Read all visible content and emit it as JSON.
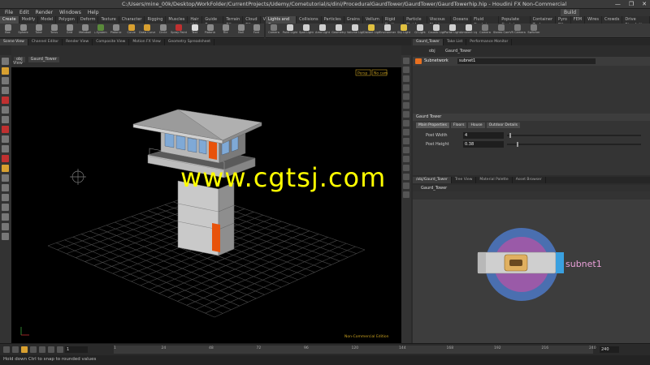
{
  "window": {
    "title": "C:/Users/mine_00k/Desktop/WorkFolder/CurrentProjects/Udemy/Cometutorial/s/dini/ProceduralGaurdTower/GaurdTower/GaurdTowerhip.hip - Houdini FX Non-Commercial",
    "controls": [
      "—",
      "❐",
      "✕"
    ]
  },
  "menu": {
    "items": [
      "File",
      "Edit",
      "Render",
      "Windows",
      "Help"
    ],
    "desktop": "Build"
  },
  "shelf_left": {
    "tabs": [
      "Create",
      "Modify",
      "Model",
      "Polygon",
      "Deform",
      "Texture",
      "Character",
      "Rigging",
      "Muscles",
      "Hair Utils",
      "Guide Process",
      "Terrain FX",
      "Cloud FX",
      "Volume"
    ],
    "active_tab": 0,
    "tools": [
      {
        "label": "Box",
        "color": "#8a8a8a"
      },
      {
        "label": "Sphere",
        "color": "#8a8a8a"
      },
      {
        "label": "Tube",
        "color": "#8a8a8a"
      },
      {
        "label": "Torus",
        "color": "#8a8a8a"
      },
      {
        "label": "Grid",
        "color": "#8a8a8a"
      },
      {
        "label": "Metaball",
        "color": "#8a8a8a"
      },
      {
        "label": "L-System",
        "color": "#5a8a3a"
      },
      {
        "label": "Platonic",
        "color": "#8a8a8a"
      },
      {
        "label": "Curve",
        "color": "#d8a030"
      },
      {
        "label": "Draw Curve",
        "color": "#d8a030"
      },
      {
        "label": "Circle",
        "color": "#8a8a8a"
      },
      {
        "label": "Spray Paint",
        "color": "#c03030"
      },
      {
        "label": "Text",
        "color": "#dddddd"
      },
      {
        "label": "Platonic",
        "color": "#8a8a8a"
      },
      {
        "label": "File",
        "color": "#8a8a8a"
      },
      {
        "label": "Null",
        "color": "#8a8a8a"
      },
      {
        "label": "Font",
        "color": "#8a8a8a"
      }
    ]
  },
  "shelf_right": {
    "tabs": [
      "Lights and Cameras",
      "Collisions",
      "Particles",
      "Grains",
      "Vellum",
      "Rigid Bodies",
      "Particle Fluids",
      "Viscous Fluids",
      "Oceans",
      "Fluid Containers",
      "Populate Containers",
      "Container Tools",
      "Pyro FX",
      "FEM",
      "Wires",
      "Crowds",
      "Drive Simulation"
    ],
    "active_tab": 0,
    "tools": [
      {
        "label": "Camera",
        "color": "#7a7a7a"
      },
      {
        "label": "Point Light",
        "color": "#d0d0d0"
      },
      {
        "label": "Spot Light",
        "color": "#d0d0d0"
      },
      {
        "label": "Area Light",
        "color": "#d0d0d0"
      },
      {
        "label": "Geometry",
        "color": "#d0d0d0"
      },
      {
        "label": "Volume Light",
        "color": "#d0d0d0"
      },
      {
        "label": "Distant Light",
        "color": "#e0c040"
      },
      {
        "label": "Environment",
        "color": "#d0d0d0"
      },
      {
        "label": "Sky Light",
        "color": "#e0c040"
      },
      {
        "label": "GI Light",
        "color": "#d0d0d0"
      },
      {
        "label": "Caustic Light",
        "color": "#d0d0d0"
      },
      {
        "label": "Portal Light",
        "color": "#d0d0d0"
      },
      {
        "label": "Ambient Light",
        "color": "#d0d0d0"
      },
      {
        "label": "Camera",
        "color": "#7a7a7a"
      },
      {
        "label": "Stereo Cam",
        "color": "#7a7a7a"
      },
      {
        "label": "VR Camera",
        "color": "#7a7a7a"
      },
      {
        "label": "Switcher",
        "color": "#7a7a7a"
      }
    ]
  },
  "viewport_tabs": [
    "Scene View",
    "Channel Editor",
    "Render View",
    "Composite View",
    "Motion FX View",
    "Geometry Spreadsheet"
  ],
  "viewport": {
    "path": [
      "obj",
      "Gaurd_Tower"
    ],
    "label": "View",
    "camera_menu": "Persp",
    "cam_menu2": "No cam",
    "edition_note": "Non-Commercial Edition"
  },
  "params": {
    "tabs": [
      "Gaurd_Tower",
      "Take List",
      "Performance Monitor"
    ],
    "path": [
      "obj",
      "Gaurd_Tower"
    ],
    "node_type": "Subnetwork",
    "node_name": "subnet1",
    "section": "Gaurd Tower",
    "param_tabs": [
      "Main Properties",
      "Floors",
      "House",
      "Outdoor Details"
    ],
    "active_param_tab": 0,
    "fields": [
      {
        "label": "Post Width",
        "value": "4",
        "fill": 0.02
      },
      {
        "label": "Post Height",
        "value": "0.38",
        "fill": 0.07
      }
    ]
  },
  "network": {
    "tabs": [
      "/obj/Gaurd_Tower",
      "Tree View",
      "Material Palette",
      "Asset Browser"
    ],
    "path": [
      "obj",
      "Gaurd_Tower"
    ],
    "selection_label": "Gaurd_Tower",
    "node_label": "subnet1"
  },
  "timeline": {
    "current_frame": "1",
    "start": "1",
    "end_frame": "240",
    "ticks": [
      "1",
      "24",
      "48",
      "72",
      "96",
      "120",
      "144",
      "168",
      "192",
      "216",
      "240"
    ]
  },
  "status": {
    "message": "Hold down Ctrl to snap to rounded values"
  },
  "watermark": {
    "text": "www.cgtsj.com"
  },
  "colors": {
    "tower_orange": "#e8520a",
    "watermark": "#ffff00",
    "node_outer": "#4a6fb0",
    "node_inner": "#9a5aa8"
  }
}
